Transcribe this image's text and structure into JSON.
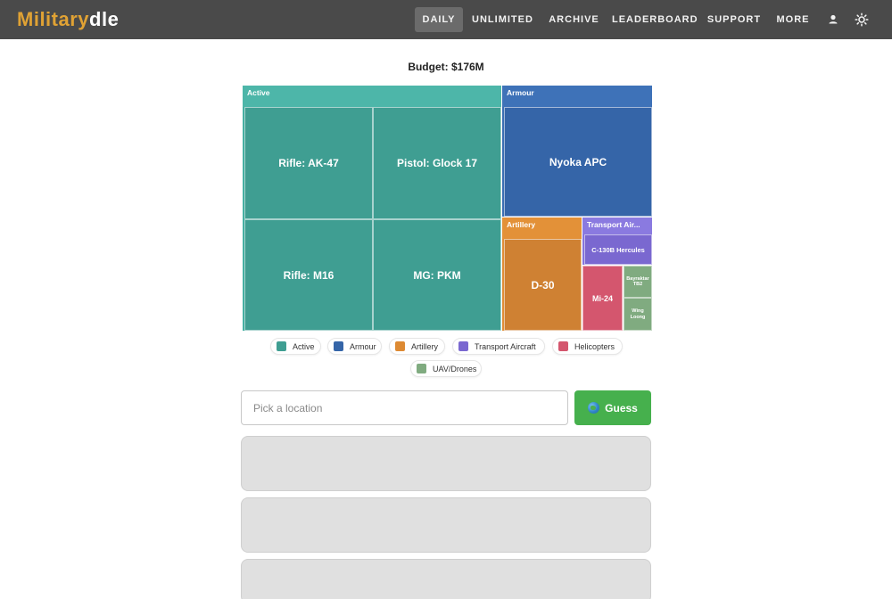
{
  "app": {
    "logo_part1": "Military",
    "logo_part2": "dle",
    "colors": {
      "nav_bg": "#4a4a4a",
      "logo_accent": "#e0a234",
      "guess_button": "#46b04d"
    }
  },
  "nav": {
    "items": [
      {
        "label": "DAILY",
        "active": true
      },
      {
        "label": "UNLIMITED",
        "active": false
      },
      {
        "label": "ARCHIVE",
        "active": false
      },
      {
        "label": "LEADERBOARD",
        "active": false
      },
      {
        "label": "SUPPORT",
        "active": false
      },
      {
        "label": "MORE",
        "active": false
      }
    ],
    "icons": [
      "user-icon",
      "sun-icon"
    ]
  },
  "budget": "Budget: $176M",
  "treemap": {
    "groups": [
      {
        "name": "Active",
        "color": "#3f9e92",
        "items": [
          "Rifle: AK-47",
          "Pistol: Glock 17",
          "Rifle: M16",
          "MG: PKM"
        ]
      },
      {
        "name": "Armour",
        "color": "#3565a8",
        "items": [
          "Nyoka APC"
        ]
      },
      {
        "name": "Artillery",
        "color": "#cf8133",
        "items": [
          "D-30"
        ]
      },
      {
        "name": "Transport Air...",
        "color": "#7a68d0",
        "items": [
          "C-130B Hercules"
        ]
      },
      {
        "name": "Helicopters",
        "color": "#d4566e",
        "items": [
          "Mi-24"
        ]
      },
      {
        "name": "UAV/Drones",
        "color": "#80ab80",
        "items": [
          "Bayraktar TB2",
          "Wing Loong"
        ]
      }
    ]
  },
  "legend": [
    {
      "label": "Active",
      "color": "#3f9e92"
    },
    {
      "label": "Armour",
      "color": "#3565a8"
    },
    {
      "label": "Artillery",
      "color": "#dd8a33"
    },
    {
      "label": "Transport Aircraft",
      "color": "#7a68d0"
    },
    {
      "label": "Helicopters",
      "color": "#d4566e"
    },
    {
      "label": "UAV/Drones",
      "color": "#80ab80"
    }
  ],
  "search": {
    "placeholder": "Pick a location",
    "value": ""
  },
  "guess_button": {
    "label": "Guess",
    "icon": "globe-icon"
  }
}
